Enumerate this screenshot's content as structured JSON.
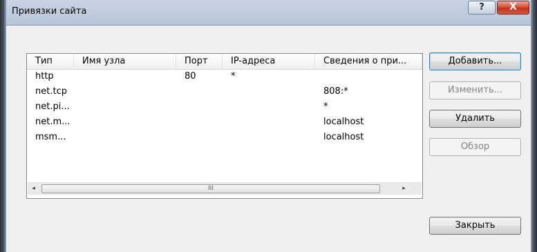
{
  "window": {
    "title": "Привязки сайта",
    "help_glyph": "?",
    "close_glyph": "X"
  },
  "list": {
    "columns": [
      "Тип",
      "Имя узла",
      "Порт",
      "IP-адреса",
      "Сведения о при..."
    ],
    "rows": [
      [
        "http",
        "",
        "80",
        "*",
        ""
      ],
      [
        "net.tcp",
        "",
        "",
        "",
        "808:*"
      ],
      [
        "net.pi...",
        "",
        "",
        "",
        "*"
      ],
      [
        "net.m...",
        "",
        "",
        "",
        "localhost"
      ],
      [
        "msm...",
        "",
        "",
        "",
        "localhost"
      ]
    ],
    "scroll_left_glyph": "◂",
    "scroll_right_glyph": "▸",
    "scroll_grip_glyph": "III"
  },
  "buttons": {
    "add": "Добавить...",
    "edit": "Изменить...",
    "remove": "Удалить",
    "browse": "Обзор",
    "close": "Закрыть"
  }
}
